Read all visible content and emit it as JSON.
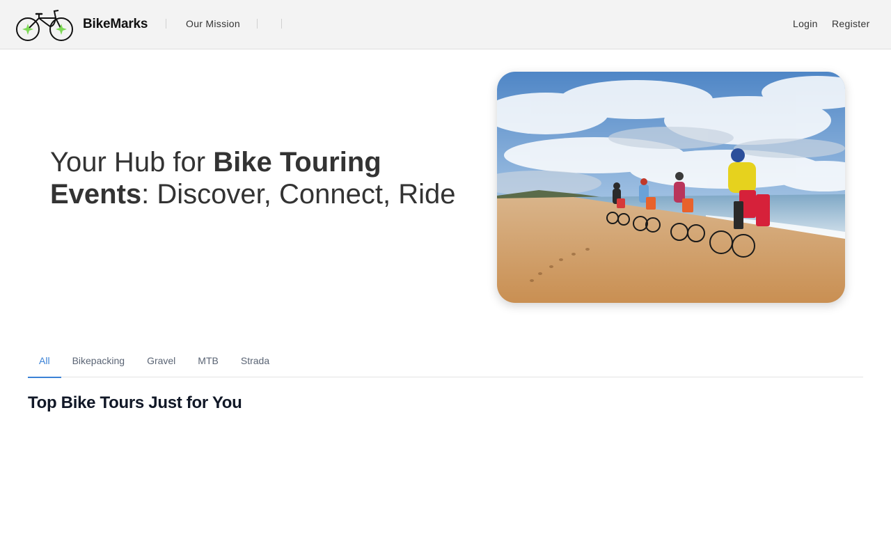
{
  "header": {
    "brand_name": "BikeMarks",
    "brand_logo_icon": "bicycle-logo-icon",
    "nav": {
      "our_mission": "Our Mission"
    },
    "auth": {
      "login": "Login",
      "register": "Register"
    }
  },
  "hero": {
    "title_part1": "Your Hub for ",
    "title_bold": "Bike Touring Events",
    "title_part2": ": Discover, Connect, Ride",
    "image_subject": "cyclists-touring-on-beach-photo"
  },
  "tabs": [
    {
      "label": "All",
      "active": true
    },
    {
      "label": "Bikepacking",
      "active": false
    },
    {
      "label": "Gravel",
      "active": false
    },
    {
      "label": "MTB",
      "active": false
    },
    {
      "label": "Strada",
      "active": false
    }
  ],
  "section": {
    "title": "Top Bike Tours Just for You"
  },
  "colors": {
    "accent": "#3b82d6",
    "header_bg": "#f3f3f3",
    "logo_sparkle": "#7ed957"
  }
}
